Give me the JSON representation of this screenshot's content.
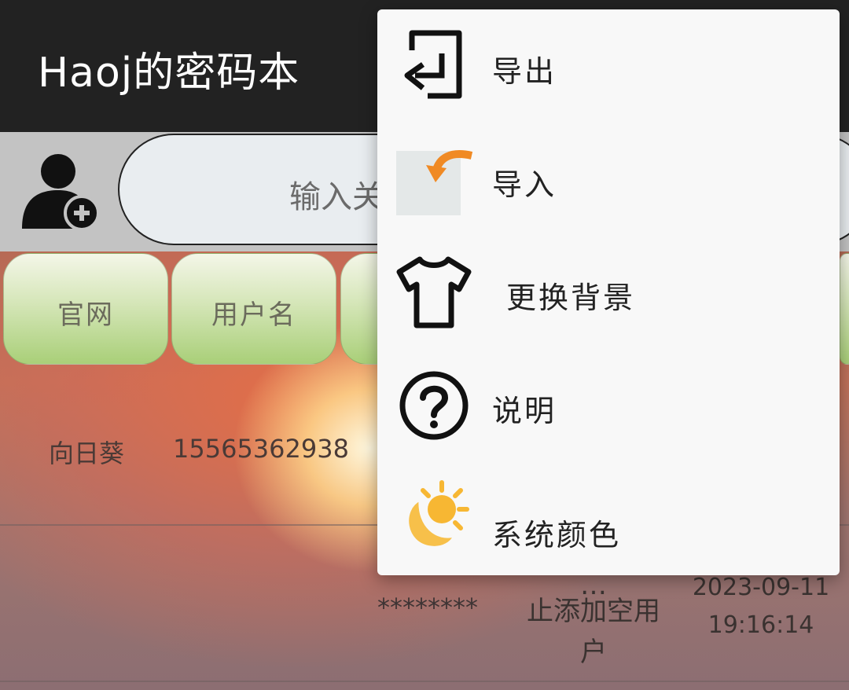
{
  "app_bar": {
    "title": "Haoj的密码本"
  },
  "search": {
    "placeholder_visible": "输入关"
  },
  "table": {
    "headers": [
      "官网",
      "用户名",
      ""
    ],
    "rows": [
      {
        "site": "向日葵",
        "username": "15565362938"
      },
      {
        "password": "********",
        "note": "止添加空用户",
        "note_lines": [
          "止添加空用",
          "户"
        ],
        "note_partial_above": "...",
        "date": "2023-09-11",
        "time": "19:16:14"
      }
    ]
  },
  "menu": {
    "items": [
      {
        "label": "导出",
        "icon": "export-icon"
      },
      {
        "label": "导入",
        "icon": "import-icon"
      },
      {
        "label": "更换背景",
        "icon": "tshirt-icon"
      },
      {
        "label": "说明",
        "icon": "help-circle-icon"
      },
      {
        "label": "系统颜色",
        "icon": "sun-moon-icon"
      }
    ]
  },
  "colors": {
    "app_bar": "#222222",
    "menu_bg": "#f8f8f8",
    "header_button_green": "#a9cf78",
    "accent_orange": "#f08a24",
    "sun_yellow": "#f7b733"
  }
}
